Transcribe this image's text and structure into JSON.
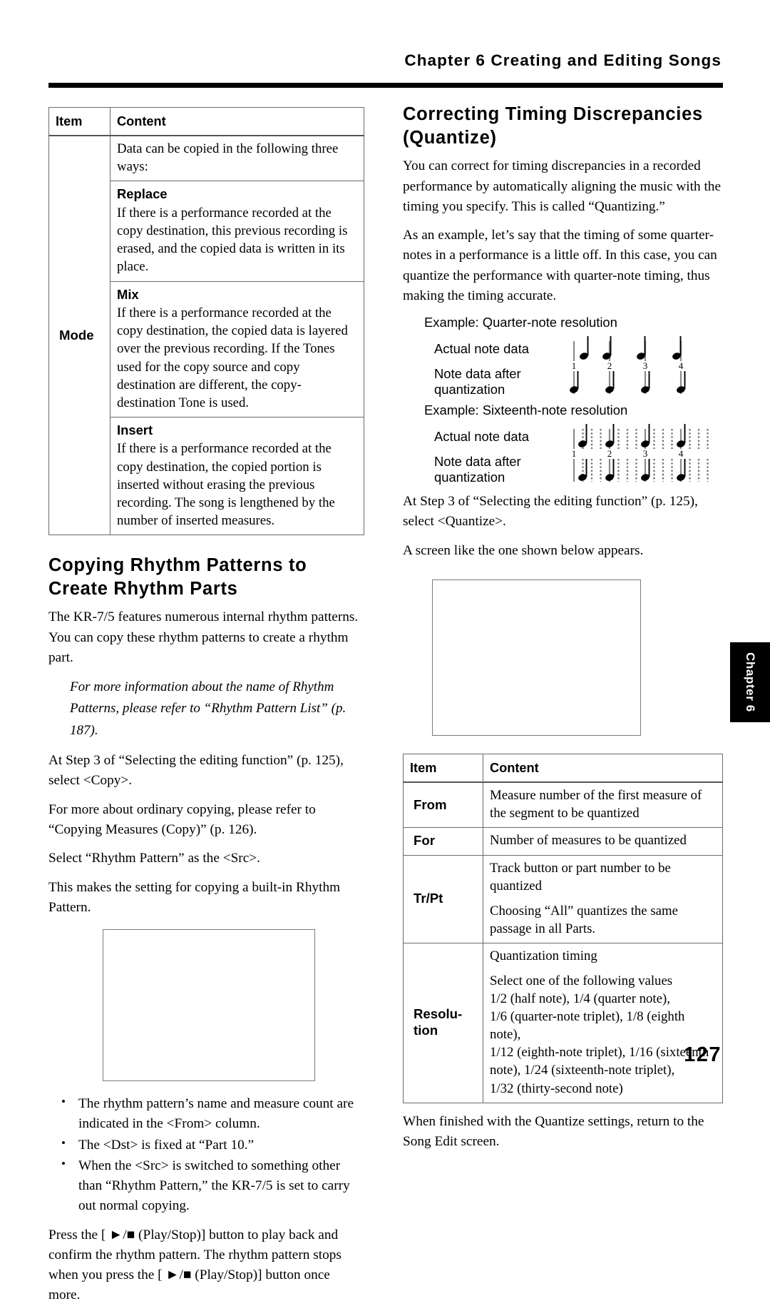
{
  "header": {
    "chapter_title": "Chapter 6 Creating and Editing Songs"
  },
  "side_tab": {
    "label": "Chapter 6"
  },
  "page_number": "127",
  "left_column": {
    "mode_table": {
      "headers": {
        "item": "Item",
        "content": "Content"
      },
      "item_label": "Mode",
      "intro": "Data can be copied in the following three ways:",
      "modes": [
        {
          "name": "Replace",
          "text": "If there is a performance recorded at the copy destination, this previous recording is erased, and the copied data is written in its place."
        },
        {
          "name": "Mix",
          "text": "If there is a performance recorded at the copy destination, the copied data is layered over the previous recording. If the Tones used for the copy source and copy destination are different, the copy-destination Tone is used."
        },
        {
          "name": "Insert",
          "text": "If there is a performance recorded at the copy destination, the copied portion is inserted without erasing the previous recording. The song is lengthened by the number of inserted measures."
        }
      ]
    },
    "section_heading": "Copying Rhythm Patterns to Create Rhythm Parts",
    "para1": "The KR-7/5 features numerous internal rhythm patterns. You can copy these rhythm patterns to create a rhythm part.",
    "note1": "For more information about the name of Rhythm Patterns, please refer to “Rhythm Pattern List” (p. 187).",
    "para2": "At Step 3 of “Selecting the editing function” (p. 125), select <Copy>.",
    "para3": "For more about ordinary copying, please refer to “Copying Measures (Copy)” (p. 126).",
    "para4": "Select “Rhythm Pattern” as the <Src>.",
    "para5": "This makes the setting for copying a built-in Rhythm Pattern.",
    "bullets": [
      "The rhythm pattern’s name and measure count are indicated in the <From> column.",
      "The <Dst> is fixed at “Part 10.”",
      "When the <Src> is switched to something other than “Rhythm Pattern,” the KR-7/5 is set to carry out normal copying."
    ],
    "para6": "Press the [ ►/■  (Play/Stop)] button to play back and confirm the rhythm pattern. The rhythm pattern stops when you press the [ ►/■  (Play/Stop)] button once more."
  },
  "right_column": {
    "section_heading": "Correcting Timing Discrepancies (Quantize)",
    "para1": "You can correct for timing discrepancies in a recorded performance by automatically aligning the music with the timing you specify. This is called “Quantizing.”",
    "para2": "As an example, let’s say that the timing of some quarter-notes in a performance is a little off. In this case, you can quantize the performance with quarter-note timing, thus making the timing accurate.",
    "figures": [
      {
        "caption": "Example: Quarter-note resolution",
        "row_labels": [
          "Actual note data",
          "Note data after quantization"
        ],
        "beat_numbers": [
          "1",
          "2",
          "3",
          "4"
        ],
        "subdivisions": 1
      },
      {
        "caption": "Example: Sixteenth-note resolution",
        "row_labels": [
          "Actual note data",
          "Note data after quantization"
        ],
        "beat_numbers": [
          "1",
          "2",
          "3",
          "4"
        ],
        "subdivisions": 4
      }
    ],
    "para3": "At Step 3 of “Selecting the editing function” (p. 125), select <Quantize>.",
    "para4": "A screen like the one shown below appears.",
    "quantize_table": {
      "headers": {
        "item": "Item",
        "content": "Content"
      },
      "rows": [
        {
          "item": "From",
          "paragraphs": [
            "Measure number of the first measure of the segment to be quantized"
          ]
        },
        {
          "item": "For",
          "paragraphs": [
            "Number of measures to be quantized"
          ]
        },
        {
          "item": "Tr/Pt",
          "paragraphs": [
            "Track button or part number to be quantized",
            "Choosing “All” quantizes the same passage in all Parts."
          ]
        },
        {
          "item": "Resolu-\ntion",
          "item_line1": "Resolu-",
          "item_line2": "tion",
          "paragraphs": [
            "Quantization timing",
            " Select one of the following values\n1/2 (half note), 1/4 (quarter note),\n1/6 (quarter-note triplet), 1/8 (eighth note),\n1/12 (eighth-note triplet), 1/16 (sixteenth note), 1/24 (sixteenth-note triplet),\n1/32 (thirty-second note)"
          ]
        }
      ]
    },
    "para5": "When finished with the Quantize settings, return to the Song Edit screen."
  }
}
